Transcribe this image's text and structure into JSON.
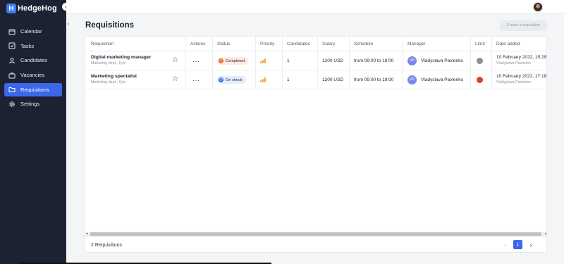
{
  "app": {
    "name": "HedgeHog",
    "logo_letter": "H"
  },
  "sidebar": {
    "items": [
      {
        "label": "Calendar",
        "icon": "calendar-icon"
      },
      {
        "label": "Tasks",
        "icon": "checkbox-icon"
      },
      {
        "label": "Candidates",
        "icon": "user-icon"
      },
      {
        "label": "Vacancies",
        "icon": "briefcase-icon"
      },
      {
        "label": "Requisitions",
        "icon": "folder-icon",
        "active": true
      },
      {
        "label": "Settings",
        "icon": "gear-icon"
      }
    ]
  },
  "page": {
    "title": "Requisitions",
    "create_button": "Create a requisition"
  },
  "table": {
    "columns": [
      "Requisition",
      "Actions",
      "Status",
      "Priority",
      "Candidates",
      "Salary",
      "Schedule",
      "Manager",
      "Limit",
      "Date added"
    ],
    "rows": [
      {
        "title": "Digital marketing manager",
        "dept": "Marketing dept., Kyiv",
        "status": "Completed",
        "status_color": "#e8734a",
        "priority_level": 3,
        "candidates": "1",
        "salary": "1200 USD",
        "schedule": "from 09:00 to 18:00",
        "manager_initials": "VP",
        "manager": "Vladyslava Pavlenko",
        "limit_color": "#8d9098",
        "date": "10 February 2022, 15:29",
        "added_by": "Vladyslava Pavlenko"
      },
      {
        "title": "Marketing specialist",
        "dept": "Marketing dept., Kyiv",
        "status": "On check",
        "status_color": "#3b68ea",
        "priority_level": 3,
        "candidates": "1",
        "salary": "1200 USD",
        "schedule": "from 09:00 to 18:00",
        "manager_initials": "VP",
        "manager": "Vladyslava Pavlenko",
        "limit_color": "#e53b2c",
        "date": "10 February 2022, 17:18",
        "added_by": "Vladyslava Pavlenko"
      }
    ]
  },
  "footer": {
    "count_text": "2 Requisitions",
    "current_page": "1"
  },
  "colors": {
    "sidebar_bg": "#1d2233",
    "accent": "#3b68ea"
  }
}
